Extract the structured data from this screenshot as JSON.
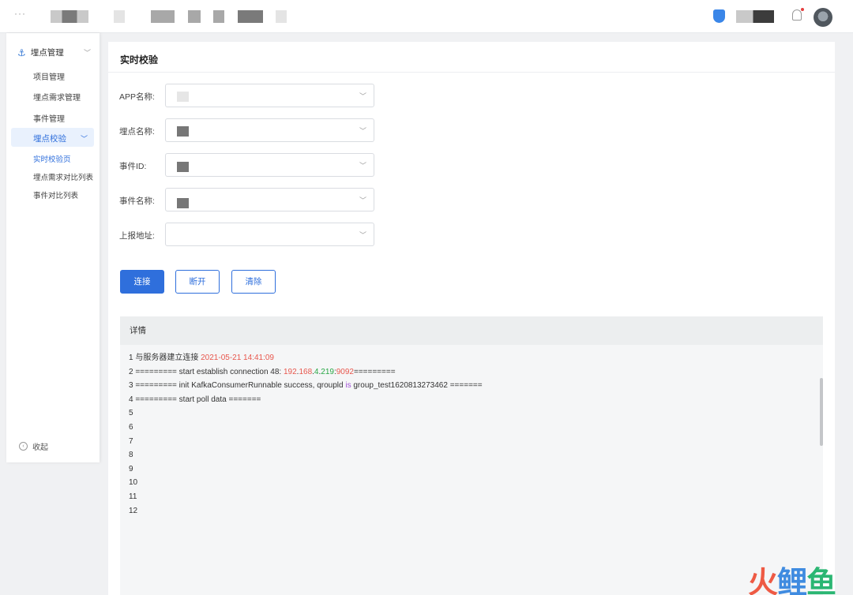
{
  "topbar": {
    "menu_dots": "···"
  },
  "sidebar": {
    "group_label": "埋点管理",
    "items": [
      "项目管理",
      "埋点需求管理",
      "事件管理"
    ],
    "active_group": "埋点校验",
    "sub_items": [
      "实时校验页",
      "埋点需求对比列表",
      "事件对比列表"
    ],
    "collapse_label": "收起"
  },
  "page": {
    "title": "实时校验"
  },
  "form": {
    "app_label": "APP名称:",
    "point_label": "埋点名称:",
    "event_id_label": "事件ID:",
    "event_name_label": "事件名称:",
    "report_url_label": "上报地址:"
  },
  "buttons": {
    "connect": "连接",
    "disconnect": "断开",
    "clear": "清除"
  },
  "detail": {
    "title": "详情",
    "lines": [
      "1 与服务器建立连接 2021-05-21 14:41:09",
      "2 ========= start establish connection 48: 192.168.4.219:9092=========",
      "3 ========= init KafkaConsumerRunnable success, qroupld is group_test1620813273462 =======",
      "4 ========= start poll data =======",
      "5",
      "6",
      "7",
      "8",
      "9",
      "10",
      "11",
      "12"
    ]
  },
  "watermark": "火鲤鱼",
  "colors": {
    "accent": "#2f6fdc",
    "log_time": "#e8574d",
    "log_ip_mid": "#28a745",
    "log_keyword": "#a150d6"
  }
}
